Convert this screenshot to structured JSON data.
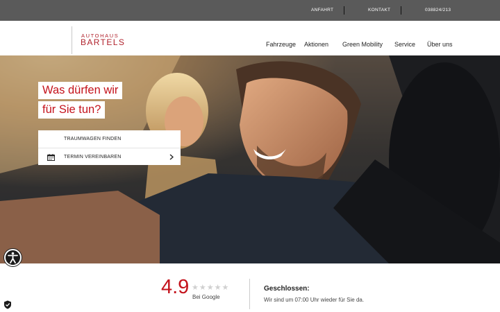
{
  "topbar": {
    "anfahrt": "ANFAHRT",
    "kontakt": "KONTAKT",
    "phone": "038824/213"
  },
  "logo": {
    "top": "AUTOHAUS",
    "bottom": "BARTELS"
  },
  "nav": [
    "Fahrzeuge",
    "Aktionen",
    "Green Mobility",
    "Service",
    "Über uns"
  ],
  "hero": {
    "headline_line1": "Was dürfen wir",
    "headline_line2": "für Sie tun?",
    "menu": [
      {
        "label": "TRAUMWAGEN FINDEN"
      },
      {
        "label": "TERMIN VEREINBAREN",
        "icon": "calendar-icon"
      }
    ]
  },
  "rating": {
    "score": "4.9",
    "source": "Bei Google",
    "stars_filled": 0,
    "stars_total": 5
  },
  "status": {
    "title": "Geschlossen:",
    "text": "Wir sind um 07:00 Uhr wieder für Sie da."
  },
  "colors": {
    "brand_red": "#c4131c",
    "topbar_bg": "#5a5a5a"
  }
}
